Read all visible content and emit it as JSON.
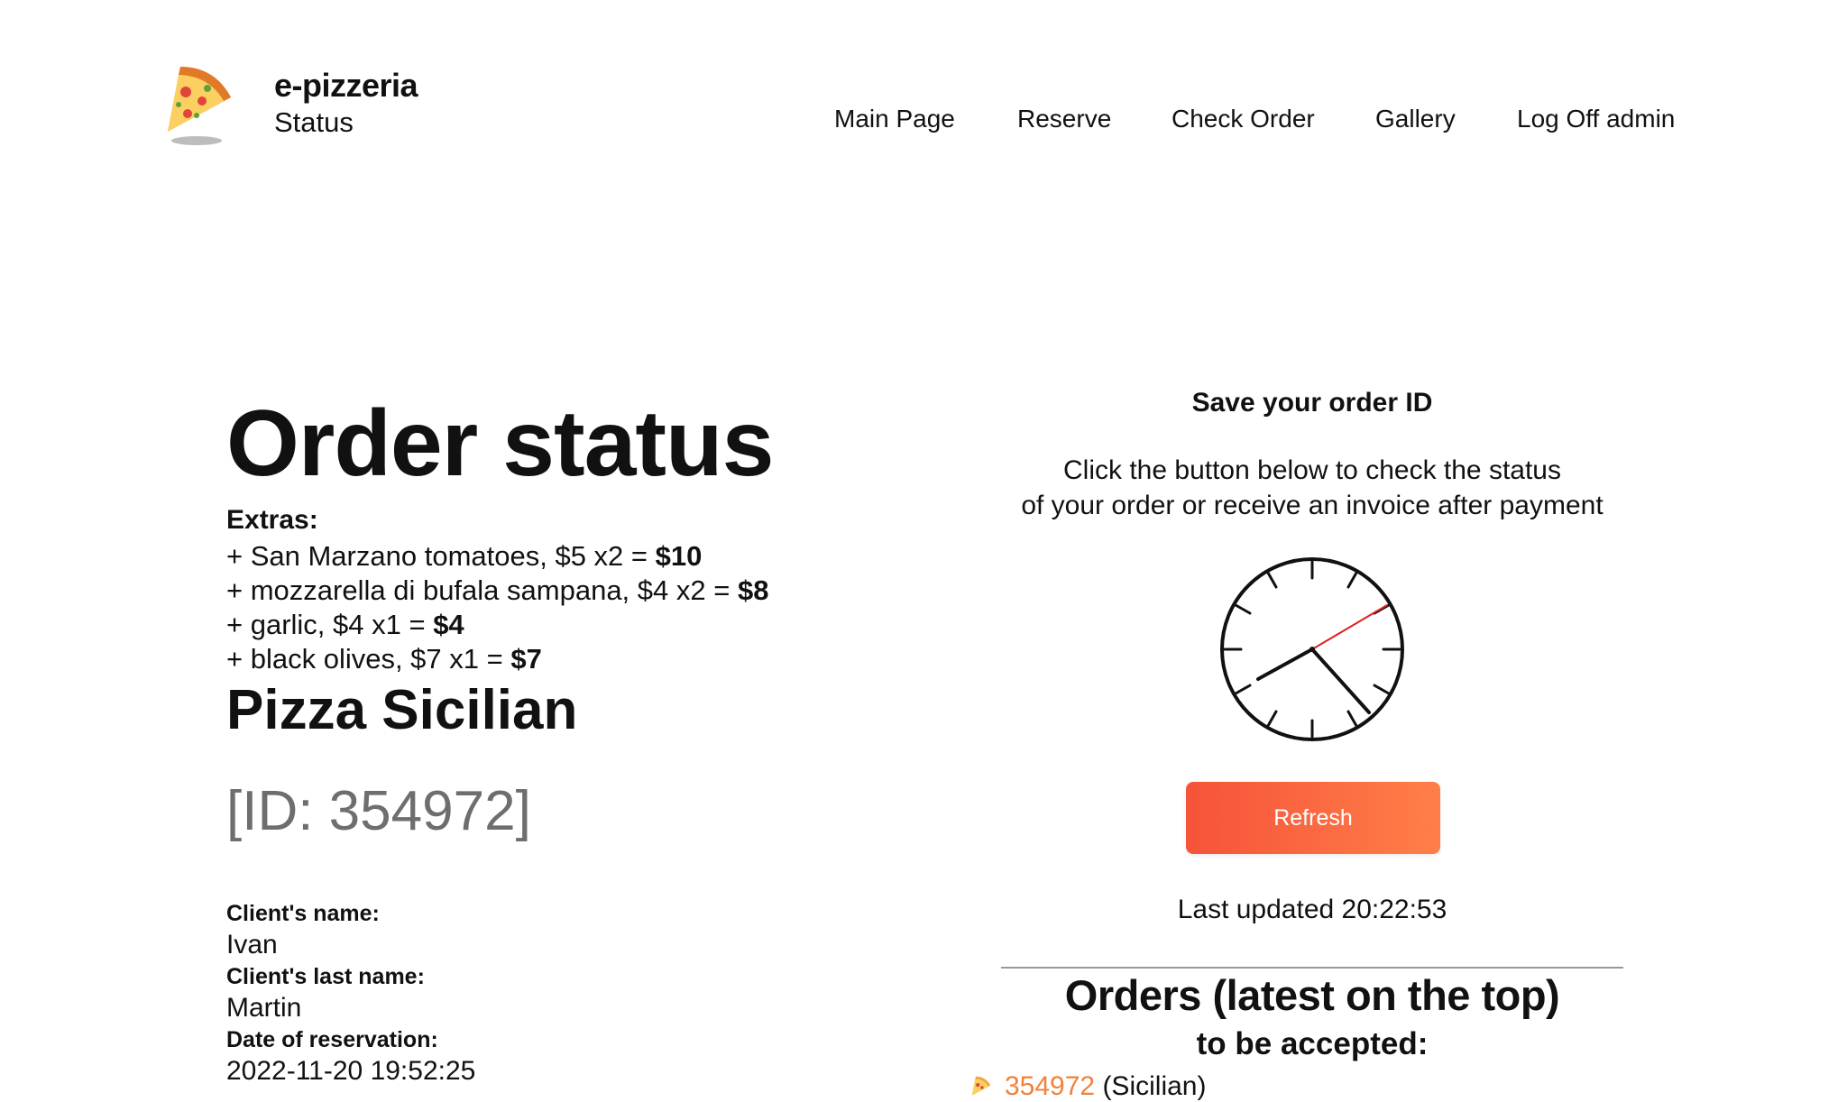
{
  "brand": {
    "title": "e-pizzeria",
    "subtitle": "Status",
    "logo_icon": "pizza-slice-icon"
  },
  "nav": {
    "items": [
      {
        "label": "Main Page"
      },
      {
        "label": "Reserve"
      },
      {
        "label": "Check Order"
      },
      {
        "label": "Gallery"
      },
      {
        "label": "Log Off admin"
      }
    ]
  },
  "order": {
    "heading": "Order status",
    "extras_label": "Extras:",
    "extras": [
      {
        "text": "+ San Marzano tomatoes, $5 x2 = ",
        "total": "$10"
      },
      {
        "text": "+ mozzarella di bufala sampana, $4 x2 = ",
        "total": "$8"
      },
      {
        "text": "+ garlic, $4 x1 = ",
        "total": "$4"
      },
      {
        "text": "+ black olives, $7 x1 = ",
        "total": "$7"
      }
    ],
    "pizza_name": "Pizza Sicilian",
    "id_text": "[ID: 354972]",
    "client": {
      "name_label": "Client's name:",
      "name": "Ivan",
      "last_name_label": "Client's last name:",
      "last_name": "Martin",
      "date_label": "Date of reservation:",
      "date": "2022-11-20 19:52:25"
    }
  },
  "status_panel": {
    "save_heading": "Save your order ID",
    "instruction_line1": "Click the button below to check the status",
    "instruction_line2": "of your order or receive an invoice after payment",
    "clock_icon": "analog-clock-icon",
    "refresh_label": "Refresh",
    "last_updated": "Last updated 20:22:53",
    "orders_heading": "Orders (latest on the top)",
    "orders_sub": "to be accepted:",
    "orders": [
      {
        "id": "354972",
        "type": " (Sicilian)"
      }
    ]
  },
  "colors": {
    "accent_start": "#f6533a",
    "accent_end": "#ff7f48",
    "link": "#f0823a",
    "id_gray": "#6e6e6e"
  }
}
